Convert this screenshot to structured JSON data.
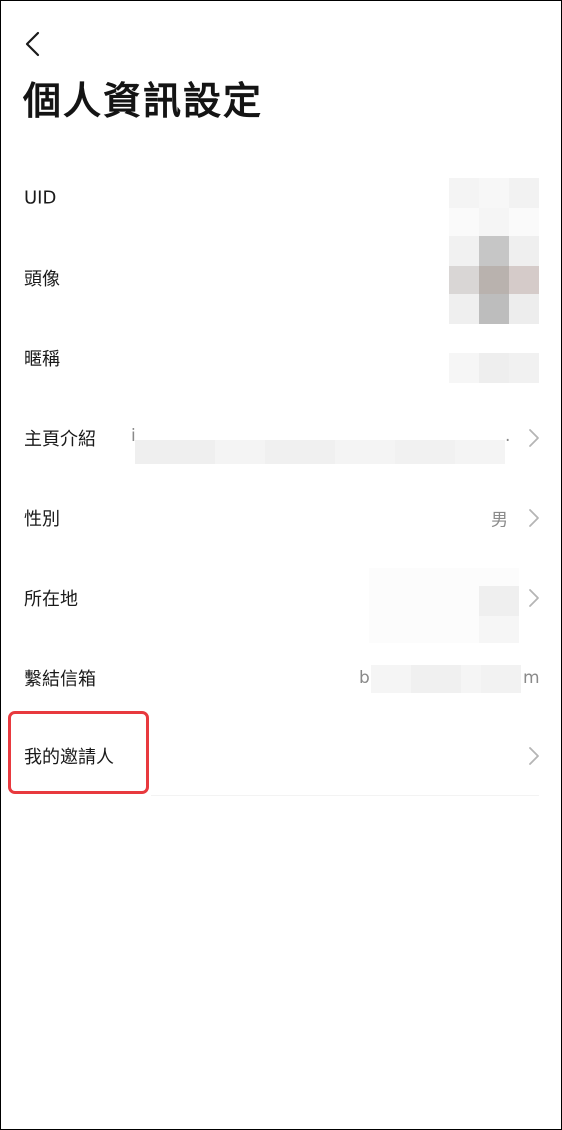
{
  "header": {
    "title": "個人資訊設定",
    "back_icon": "chevron-left-icon"
  },
  "rows": {
    "uid": {
      "label": "UID"
    },
    "avatar": {
      "label": "頭像"
    },
    "nickname": {
      "label": "暱稱"
    },
    "bio": {
      "label": "主頁介紹",
      "value_start": "i",
      "value_end": "."
    },
    "gender": {
      "label": "性別",
      "value": "男"
    },
    "location": {
      "label": "所在地"
    },
    "email": {
      "label": "繫結信箱",
      "value_start": "b",
      "value_end": "m"
    },
    "inviter": {
      "label": "我的邀請人"
    }
  },
  "icons": {
    "chevron": "chevron-right-icon"
  },
  "colors": {
    "highlight": "#e8393e",
    "chevron": "#b5b5b5",
    "text_primary": "#1a1a1a",
    "text_secondary": "#8a8a8a"
  }
}
